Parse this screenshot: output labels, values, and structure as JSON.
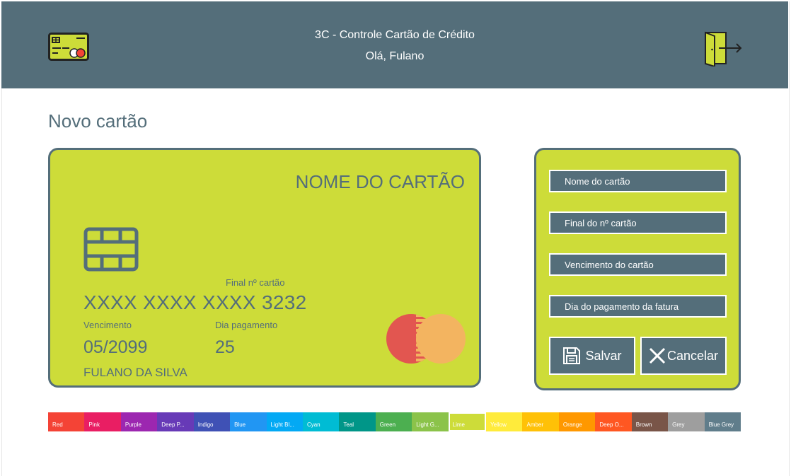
{
  "header": {
    "title": "3C - Controle Cartão de Crédito",
    "greeting": "Olá, Fulano"
  },
  "page": {
    "title": "Novo cartão"
  },
  "card_preview": {
    "name": "NOME DO CARTÃO",
    "final_label": "Final nº cartão",
    "number": "XXXX XXXX XXXX 3232",
    "due_label": "Vencimento",
    "payment_label": "Dia pagamento",
    "due_value": "05/2099",
    "payment_value": "25",
    "holder": "FULANO DA SILVA",
    "color": "#cddc39"
  },
  "form": {
    "name_placeholder": "Nome do cartão",
    "final_placeholder": "Final do nº cartão",
    "due_placeholder": "Vencimento do cartão",
    "payment_placeholder": "Dia do pagamento da fatura",
    "save_label": "Salvar",
    "cancel_label": "Cancelar"
  },
  "palette": {
    "selected": "Lime",
    "swatches": [
      {
        "label": "Red",
        "color": "#f44336"
      },
      {
        "label": "Pink",
        "color": "#e91e63"
      },
      {
        "label": "Purple",
        "color": "#9c27b0"
      },
      {
        "label": "Deep P...",
        "color": "#673ab7"
      },
      {
        "label": "Indigo",
        "color": "#3f51b5"
      },
      {
        "label": "Blue",
        "color": "#2196f3"
      },
      {
        "label": "Light Bl...",
        "color": "#03a9f4"
      },
      {
        "label": "Cyan",
        "color": "#00bcd4"
      },
      {
        "label": "Teal",
        "color": "#009688"
      },
      {
        "label": "Green",
        "color": "#4caf50"
      },
      {
        "label": "Light G...",
        "color": "#8bc34a"
      },
      {
        "label": "Lime",
        "color": "#cddc39"
      },
      {
        "label": "Yellow",
        "color": "#ffeb3b"
      },
      {
        "label": "Amber",
        "color": "#ffc107"
      },
      {
        "label": "Orange",
        "color": "#ff9800"
      },
      {
        "label": "Deep O...",
        "color": "#ff5722"
      },
      {
        "label": "Brown",
        "color": "#795548"
      },
      {
        "label": "Grey",
        "color": "#9e9e9e"
      },
      {
        "label": "Blue Grey",
        "color": "#607d8b"
      }
    ]
  },
  "colors": {
    "primary": "#546e7a",
    "accent": "#cddc39"
  },
  "icons": {
    "logo": "credit-card-icon",
    "logout": "exit-door-icon",
    "chip": "card-chip-icon",
    "brand": "mastercard-icon",
    "save": "floppy-disk-icon",
    "cancel": "close-x-icon"
  }
}
